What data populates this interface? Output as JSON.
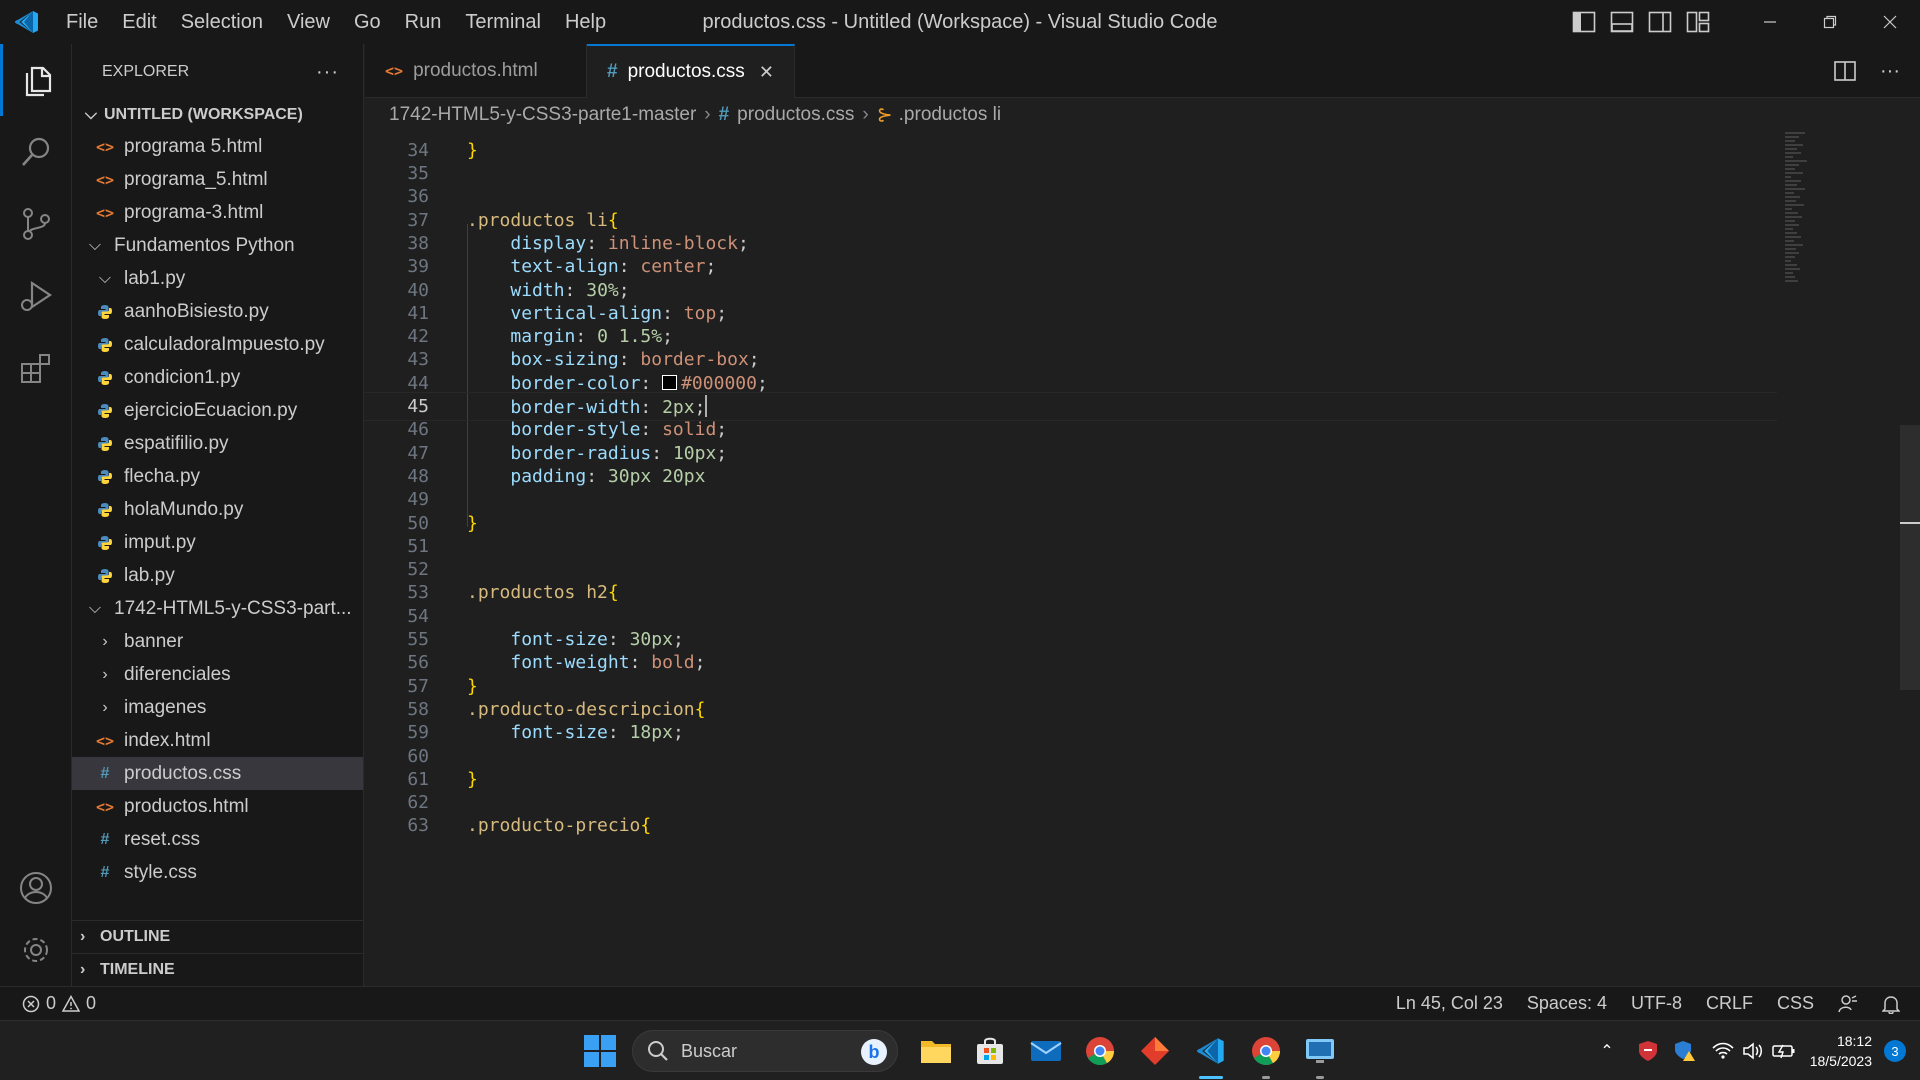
{
  "window": {
    "title": "productos.css - Untitled (Workspace) - Visual Studio Code",
    "menu": [
      "File",
      "Edit",
      "Selection",
      "View",
      "Go",
      "Run",
      "Terminal",
      "Help"
    ]
  },
  "sidebar": {
    "header": "EXPLORER",
    "more": "···",
    "workspace": "UNTITLED (WORKSPACE)",
    "tree": [
      {
        "label": "programa 5.html",
        "icon": "html-file-icon",
        "depth": 2
      },
      {
        "label": "programa_5.html",
        "icon": "html-file-icon",
        "depth": 2
      },
      {
        "label": "programa-3.html",
        "icon": "html-file-icon",
        "depth": 2
      },
      {
        "label": "Fundamentos Python",
        "icon": "chevron-down-icon",
        "depth": 1
      },
      {
        "label": "lab1.py",
        "icon": "chevron-down-icon",
        "depth": 2
      },
      {
        "label": "aanhoBisiesto.py",
        "icon": "python-file-icon",
        "depth": 2
      },
      {
        "label": "calculadoraImpuesto.py",
        "icon": "python-file-icon",
        "depth": 2
      },
      {
        "label": "condicion1.py",
        "icon": "python-file-icon",
        "depth": 2
      },
      {
        "label": "ejercicioEcuacion.py",
        "icon": "python-file-icon",
        "depth": 2
      },
      {
        "label": "espatifilio.py",
        "icon": "python-file-icon",
        "depth": 2
      },
      {
        "label": "flecha.py",
        "icon": "python-file-icon",
        "depth": 2
      },
      {
        "label": "holaMundo.py",
        "icon": "python-file-icon",
        "depth": 2
      },
      {
        "label": "imput.py",
        "icon": "python-file-icon",
        "depth": 2
      },
      {
        "label": "lab.py",
        "icon": "python-file-icon",
        "depth": 2
      },
      {
        "label": "1742-HTML5-y-CSS3-part...",
        "icon": "chevron-down-icon",
        "depth": 1
      },
      {
        "label": "banner",
        "icon": "chevron-right-icon",
        "depth": 2
      },
      {
        "label": "diferenciales",
        "icon": "chevron-right-icon",
        "depth": 2
      },
      {
        "label": "imagenes",
        "icon": "chevron-right-icon",
        "depth": 2
      },
      {
        "label": "index.html",
        "icon": "html-file-icon",
        "depth": 2
      },
      {
        "label": "productos.css",
        "icon": "css-file-icon",
        "depth": 2,
        "selected": true
      },
      {
        "label": "productos.html",
        "icon": "html-file-icon",
        "depth": 2
      },
      {
        "label": "reset.css",
        "icon": "css-file-icon",
        "depth": 2
      },
      {
        "label": "style.css",
        "icon": "css-file-icon",
        "depth": 2
      }
    ],
    "outline": "OUTLINE",
    "timeline": "TIMELINE"
  },
  "tabs": [
    {
      "label": "productos.html",
      "icon": "html-file-icon",
      "active": false
    },
    {
      "label": "productos.css",
      "icon": "css-file-icon",
      "active": true
    }
  ],
  "tab_close": "✕",
  "breadcrumb": {
    "folder": "1742-HTML5-y-CSS3-parte1-master",
    "file": "productos.css",
    "symbol": ".productos li"
  },
  "editor": {
    "current_line": 45,
    "lines": [
      {
        "n": "34",
        "tokens": [
          [
            "brace",
            "}"
          ]
        ]
      },
      {
        "n": "35",
        "tokens": []
      },
      {
        "n": "36",
        "tokens": []
      },
      {
        "n": "37",
        "tokens": [
          [
            "sel",
            ".productos li"
          ],
          [
            "brace",
            "{"
          ]
        ]
      },
      {
        "n": "38",
        "tokens": [
          [
            "punc",
            "    "
          ],
          [
            "prop",
            "display"
          ],
          [
            "punc",
            ": "
          ],
          [
            "val",
            "inline-block"
          ],
          [
            "punc",
            ";"
          ]
        ]
      },
      {
        "n": "39",
        "tokens": [
          [
            "punc",
            "    "
          ],
          [
            "prop",
            "text-align"
          ],
          [
            "punc",
            ": "
          ],
          [
            "val",
            "center"
          ],
          [
            "punc",
            ";"
          ]
        ]
      },
      {
        "n": "40",
        "tokens": [
          [
            "punc",
            "    "
          ],
          [
            "prop",
            "width"
          ],
          [
            "punc",
            ": "
          ],
          [
            "num",
            "30%"
          ],
          [
            "punc",
            ";"
          ]
        ]
      },
      {
        "n": "41",
        "tokens": [
          [
            "punc",
            "    "
          ],
          [
            "prop",
            "vertical-align"
          ],
          [
            "punc",
            ": "
          ],
          [
            "val",
            "top"
          ],
          [
            "punc",
            ";"
          ]
        ]
      },
      {
        "n": "42",
        "tokens": [
          [
            "punc",
            "    "
          ],
          [
            "prop",
            "margin"
          ],
          [
            "punc",
            ": "
          ],
          [
            "num",
            "0 1.5%"
          ],
          [
            "punc",
            ";"
          ]
        ]
      },
      {
        "n": "43",
        "tokens": [
          [
            "punc",
            "    "
          ],
          [
            "prop",
            "box-sizing"
          ],
          [
            "punc",
            ": "
          ],
          [
            "val",
            "border-box"
          ],
          [
            "punc",
            ";"
          ]
        ]
      },
      {
        "n": "44",
        "tokens": [
          [
            "punc",
            "    "
          ],
          [
            "prop",
            "border-color"
          ],
          [
            "punc",
            ": "
          ],
          [
            "swatch",
            ""
          ],
          [
            "val",
            "#000000"
          ],
          [
            "punc",
            ";"
          ]
        ]
      },
      {
        "n": "45",
        "tokens": [
          [
            "punc",
            "    "
          ],
          [
            "prop",
            "border-width"
          ],
          [
            "punc",
            ": "
          ],
          [
            "num",
            "2px"
          ],
          [
            "punc",
            ";"
          ],
          [
            "cursor",
            ""
          ]
        ]
      },
      {
        "n": "46",
        "tokens": [
          [
            "punc",
            "    "
          ],
          [
            "prop",
            "border-style"
          ],
          [
            "punc",
            ": "
          ],
          [
            "val",
            "solid"
          ],
          [
            "punc",
            ";"
          ]
        ]
      },
      {
        "n": "47",
        "tokens": [
          [
            "punc",
            "    "
          ],
          [
            "prop",
            "border-radius"
          ],
          [
            "punc",
            ": "
          ],
          [
            "num",
            "10px"
          ],
          [
            "punc",
            ";"
          ]
        ]
      },
      {
        "n": "48",
        "tokens": [
          [
            "punc",
            "    "
          ],
          [
            "prop",
            "padding"
          ],
          [
            "punc",
            ": "
          ],
          [
            "num",
            "30px 20px"
          ]
        ]
      },
      {
        "n": "49",
        "tokens": []
      },
      {
        "n": "50",
        "tokens": [
          [
            "brace",
            "}"
          ]
        ]
      },
      {
        "n": "51",
        "tokens": []
      },
      {
        "n": "52",
        "tokens": []
      },
      {
        "n": "53",
        "tokens": [
          [
            "sel",
            ".productos h2"
          ],
          [
            "brace",
            "{"
          ]
        ]
      },
      {
        "n": "54",
        "tokens": []
      },
      {
        "n": "55",
        "tokens": [
          [
            "punc",
            "    "
          ],
          [
            "prop",
            "font-size"
          ],
          [
            "punc",
            ": "
          ],
          [
            "num",
            "30px"
          ],
          [
            "punc",
            ";"
          ]
        ]
      },
      {
        "n": "56",
        "tokens": [
          [
            "punc",
            "    "
          ],
          [
            "prop",
            "font-weight"
          ],
          [
            "punc",
            ": "
          ],
          [
            "val",
            "bold"
          ],
          [
            "punc",
            ";"
          ]
        ]
      },
      {
        "n": "57",
        "tokens": [
          [
            "brace",
            "}"
          ]
        ]
      },
      {
        "n": "58",
        "tokens": [
          [
            "sel",
            ".producto-descripcion"
          ],
          [
            "brace",
            "{"
          ]
        ]
      },
      {
        "n": "59",
        "tokens": [
          [
            "punc",
            "    "
          ],
          [
            "prop",
            "font-size"
          ],
          [
            "punc",
            ": "
          ],
          [
            "num",
            "18px"
          ],
          [
            "punc",
            ";"
          ]
        ]
      },
      {
        "n": "60",
        "tokens": []
      },
      {
        "n": "61",
        "tokens": [
          [
            "brace",
            "}"
          ]
        ]
      },
      {
        "n": "62",
        "tokens": []
      },
      {
        "n": "63",
        "tokens": [
          [
            "sel",
            ".producto-precio"
          ],
          [
            "brace",
            "{"
          ]
        ]
      }
    ]
  },
  "statusbar": {
    "errors": "0",
    "warnings": "0",
    "position": "Ln 45, Col 23",
    "spaces": "Spaces: 4",
    "encoding": "UTF-8",
    "eol": "CRLF",
    "language": "CSS"
  },
  "taskbar": {
    "search_placeholder": "Buscar",
    "bing_glyph": "b",
    "time": "18:12",
    "date": "18/5/2023",
    "notifications": "3"
  },
  "colors": {
    "accent": "#0078d4",
    "selector": "#d7ba7d",
    "property": "#9cdcfe",
    "value": "#ce9178",
    "number": "#b5cea8",
    "brace": "#ffd700"
  }
}
